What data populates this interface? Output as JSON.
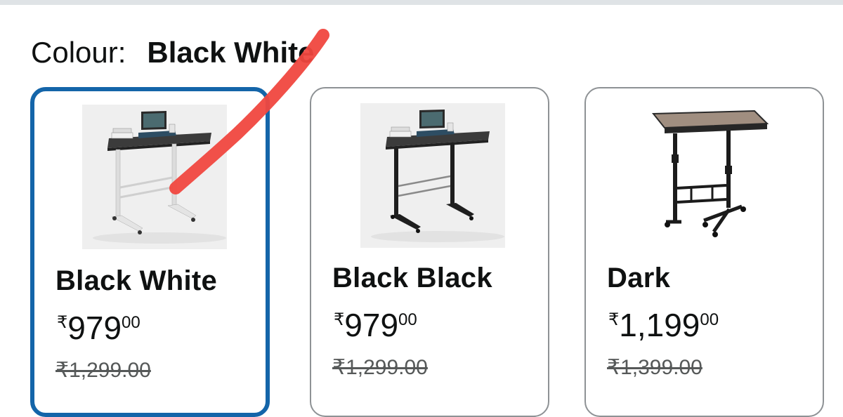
{
  "colour_selector": {
    "label": "Colour:",
    "selected_value": "Black White"
  },
  "options": [
    {
      "name": "Black White",
      "currency_symbol": "₹",
      "price_whole": "979",
      "price_fraction": "00",
      "list_price": "₹1,299.00",
      "selected": true,
      "image": "desk-white-frame"
    },
    {
      "name": "Black Black",
      "currency_symbol": "₹",
      "price_whole": "979",
      "price_fraction": "00",
      "list_price": "₹1,299.00",
      "selected": false,
      "image": "desk-black-frame"
    },
    {
      "name": "Dark",
      "currency_symbol": "₹",
      "price_whole": "1,199",
      "price_fraction": "00",
      "list_price": "₹1,399.00",
      "selected": false,
      "image": "desk-wood-top"
    }
  ],
  "colors": {
    "selected_border": "#1465a9",
    "card_border": "#8e9295",
    "annotation_stroke": "#f0473f",
    "strike_price": "#565959"
  }
}
